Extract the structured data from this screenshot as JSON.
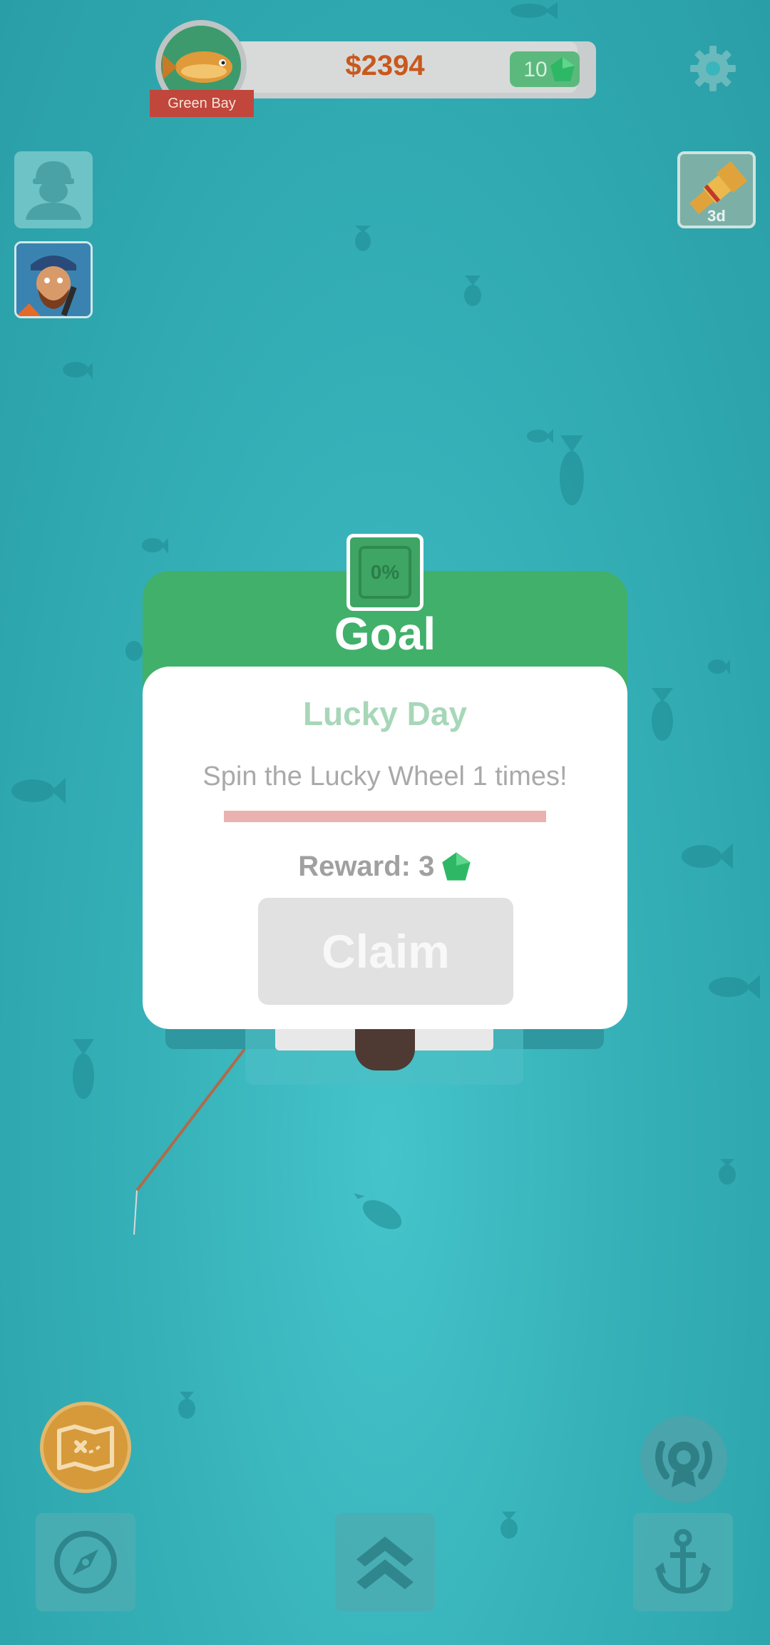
{
  "hud": {
    "money": "$2394",
    "gems": "10",
    "location": "Green Bay"
  },
  "event": {
    "timer": "3d"
  },
  "goal_modal": {
    "progress_label": "0%",
    "progress_fraction": 0,
    "title": "Goal",
    "quest_name": "Lucky Day",
    "description": "Spin the Lucky Wheel 1 times!",
    "reward_label": "Reward: 3",
    "claim_label": "Claim"
  },
  "colors": {
    "ocean": "#3ab5bc",
    "goal_green": "#41b06a",
    "money_orange": "#c9581c",
    "progress_track": "#ebb0b0",
    "claim_disabled": "#e1e1e1"
  },
  "icons": [
    "settings-gear-icon",
    "profile-silhouette-icon",
    "captain-portrait-icon",
    "spyglass-event-icon",
    "gem-icon",
    "treasure-map-icon",
    "trophy-laurel-icon",
    "compass-icon",
    "upgrade-chevrons-icon",
    "anchor-icon"
  ]
}
